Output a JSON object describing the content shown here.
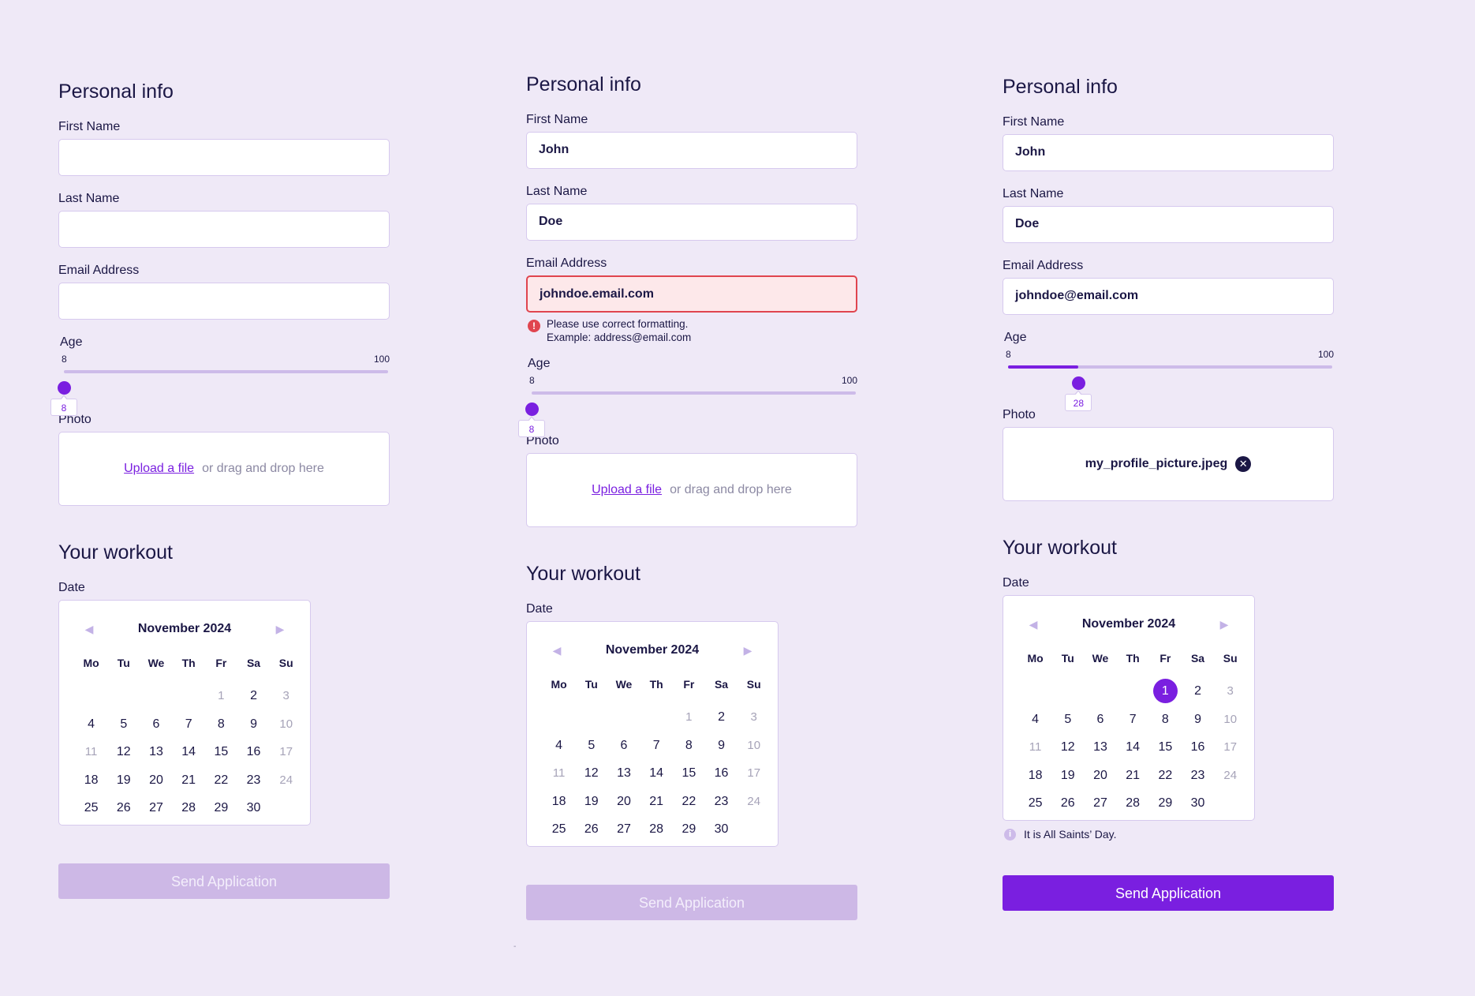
{
  "labels": {
    "personal_info": "Personal info",
    "first_name": "First Name",
    "last_name": "Last Name",
    "email": "Email Address",
    "age": "Age",
    "photo": "Photo",
    "workout": "Your workout",
    "date": "Date",
    "upload_link": "Upload a file",
    "upload_hint": "or drag and drop here",
    "submit": "Send Application"
  },
  "calendar": {
    "month": "November 2024",
    "weekdays": [
      "Mo",
      "Tu",
      "We",
      "Th",
      "Fr",
      "Sa",
      "Su"
    ],
    "leading_blanks": 4,
    "days": 30,
    "muted_days": [
      1,
      3,
      10,
      11,
      17,
      24
    ],
    "prev_icon": "triangle-left-icon",
    "next_icon": "triangle-right-icon"
  },
  "slider": {
    "min": "8",
    "max": "100"
  },
  "colors": {
    "accent": "#7a1fe0",
    "error": "#e0454f",
    "background": "#efe9f7",
    "disabled": "#cdb8e6"
  },
  "forms": [
    {
      "state": "empty",
      "first_name": "",
      "last_name": "",
      "email": "",
      "age_value": "8",
      "age_fraction": 0,
      "photo_file": null,
      "selected_day": null,
      "note": null,
      "submit_enabled": false
    },
    {
      "state": "error",
      "first_name": "John",
      "last_name": "Doe",
      "email": "johndoe.email.com",
      "email_error_line1": "Please use correct formatting.",
      "email_error_line2": "Example: address@email.com",
      "age_value": "8",
      "age_fraction": 0,
      "photo_file": null,
      "selected_day": null,
      "note": null,
      "submit_enabled": false
    },
    {
      "state": "complete",
      "first_name": "John",
      "last_name": "Doe",
      "email": "johndoe@email.com",
      "age_value": "28",
      "age_fraction": 0.2174,
      "photo_file": "my_profile_picture.jpeg",
      "selected_day": 1,
      "note": "It is All Saints’ Day.",
      "submit_enabled": true
    }
  ]
}
